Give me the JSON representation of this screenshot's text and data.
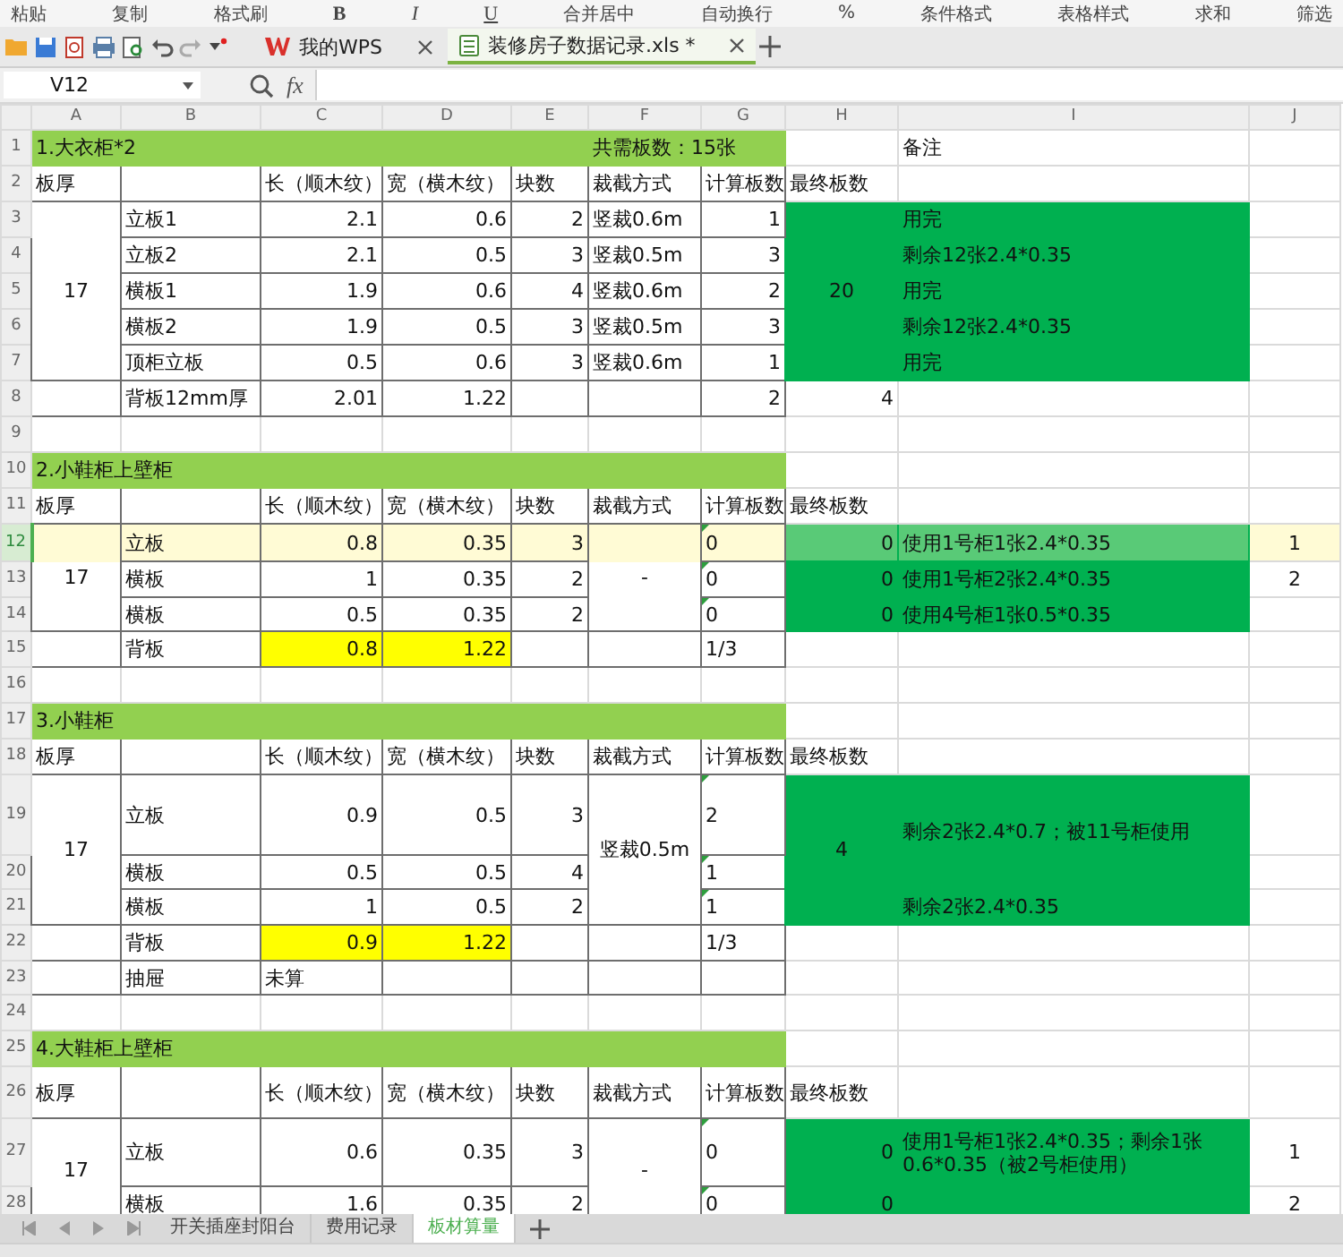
{
  "ribbon": [
    {
      "kind": "label",
      "text": "粘贴"
    },
    {
      "kind": "label",
      "text": "复制"
    },
    {
      "kind": "label",
      "text": "格式刷"
    },
    {
      "kind": "bold",
      "text": "B"
    },
    {
      "kind": "italic",
      "text": "I"
    },
    {
      "kind": "underline",
      "text": "U"
    },
    {
      "kind": "label",
      "text": "合并居中"
    },
    {
      "kind": "label",
      "text": "自动换行"
    },
    {
      "kind": "label",
      "text": "%"
    },
    {
      "kind": "label",
      "text": "条件格式"
    },
    {
      "kind": "label",
      "text": "表格样式"
    },
    {
      "kind": "label",
      "text": "求和"
    },
    {
      "kind": "label",
      "text": "筛选"
    }
  ],
  "doc_tabs": [
    {
      "label": "我的WPS",
      "kind": "home",
      "selected": false
    },
    {
      "label": "装修房子数据记录.xls *",
      "kind": "sheet",
      "selected": true
    }
  ],
  "formula_bar": {
    "cell_ref": "V12",
    "function_label": "fx"
  },
  "sheet": {
    "columns": [
      "A",
      "B",
      "C",
      "D",
      "E",
      "F",
      "G",
      "H",
      "I",
      "J"
    ],
    "rows": [
      {
        "number": "1",
        "selected": false,
        "framed": false,
        "cells": {
          "A": {
            "kind": "label",
            "text": "1.大衣柜*2",
            "color": "#92d050"
          },
          "F": {
            "kind": "label",
            "text": "共需板数：15张",
            "color": "#92d050"
          },
          "I": {
            "kind": "label",
            "text": "备注"
          }
        }
      },
      {
        "number": "2",
        "selected": false,
        "framed": true,
        "cells": {
          "A": {
            "kind": "label",
            "text": "板厚"
          },
          "C": {
            "kind": "label",
            "text": "长（顺木纹）"
          },
          "D": {
            "kind": "label",
            "text": "宽（横木纹）"
          },
          "E": {
            "kind": "label",
            "text": "块数"
          },
          "F": {
            "kind": "label",
            "text": "裁截方式"
          },
          "G": {
            "kind": "label",
            "text": "计算板数"
          },
          "H": {
            "kind": "label",
            "text": "最终板数"
          }
        }
      },
      {
        "number": "3",
        "selected": false,
        "framed": true,
        "cells": {
          "A": {
            "kind": "centered",
            "text": "17"
          },
          "B": {
            "kind": "label",
            "text": "立板1"
          },
          "C": {
            "kind": "number",
            "text": "2.1"
          },
          "D": {
            "kind": "number",
            "text": "0.6"
          },
          "E": {
            "kind": "number",
            "text": "2"
          },
          "F": {
            "kind": "label",
            "text": "竖裁0.6m"
          },
          "G": {
            "kind": "number",
            "text": "1"
          },
          "H": {
            "kind": "centered",
            "text": "20",
            "color": "#00b050"
          },
          "I": {
            "kind": "label",
            "text": "用完",
            "color": "#00b050"
          }
        }
      },
      {
        "number": "4",
        "selected": false,
        "framed": true,
        "cells": {
          "B": {
            "kind": "label",
            "text": "立板2"
          },
          "C": {
            "kind": "number",
            "text": "2.1"
          },
          "D": {
            "kind": "number",
            "text": "0.5"
          },
          "E": {
            "kind": "number",
            "text": "3"
          },
          "F": {
            "kind": "label",
            "text": "竖裁0.5m"
          },
          "G": {
            "kind": "number",
            "text": "3"
          },
          "I": {
            "kind": "label",
            "text": "剩余12张2.4*0.35",
            "color": "#00b050"
          }
        }
      },
      {
        "number": "5",
        "selected": false,
        "framed": true,
        "cells": {
          "B": {
            "kind": "label",
            "text": "横板1"
          },
          "C": {
            "kind": "number",
            "text": "1.9"
          },
          "D": {
            "kind": "number",
            "text": "0.6"
          },
          "E": {
            "kind": "number",
            "text": "4"
          },
          "F": {
            "kind": "label",
            "text": "竖裁0.6m"
          },
          "G": {
            "kind": "number",
            "text": "2"
          },
          "I": {
            "kind": "label",
            "text": "用完",
            "color": "#00b050"
          }
        }
      },
      {
        "number": "6",
        "selected": false,
        "framed": true,
        "cells": {
          "B": {
            "kind": "label",
            "text": "横板2"
          },
          "C": {
            "kind": "number",
            "text": "1.9"
          },
          "D": {
            "kind": "number",
            "text": "0.5"
          },
          "E": {
            "kind": "number",
            "text": "3"
          },
          "F": {
            "kind": "label",
            "text": "竖裁0.5m"
          },
          "G": {
            "kind": "number",
            "text": "3"
          },
          "I": {
            "kind": "label",
            "text": "剩余12张2.4*0.35",
            "color": "#00b050"
          }
        }
      },
      {
        "number": "7",
        "selected": false,
        "framed": true,
        "cells": {
          "B": {
            "kind": "label",
            "text": "顶柜立板"
          },
          "C": {
            "kind": "number",
            "text": "0.5"
          },
          "D": {
            "kind": "number",
            "text": "0.6"
          },
          "E": {
            "kind": "number",
            "text": "3"
          },
          "F": {
            "kind": "label",
            "text": "竖裁0.6m"
          },
          "G": {
            "kind": "number",
            "text": "1"
          },
          "I": {
            "kind": "label",
            "text": "用完",
            "color": "#00b050"
          }
        }
      },
      {
        "number": "8",
        "selected": false,
        "framed": true,
        "cells": {
          "B": {
            "kind": "label",
            "text": "背板12mm厚"
          },
          "C": {
            "kind": "number",
            "text": "2.01"
          },
          "D": {
            "kind": "number",
            "text": "1.22"
          },
          "G": {
            "kind": "number",
            "text": "2"
          },
          "H": {
            "kind": "number",
            "text": "4"
          }
        }
      },
      {
        "number": "9",
        "selected": false,
        "framed": false,
        "cells": {}
      },
      {
        "number": "10",
        "selected": false,
        "framed": false,
        "cells": {
          "A": {
            "kind": "label",
            "text": "2.小鞋柜上壁柜",
            "color": "#92d050"
          }
        }
      },
      {
        "number": "11",
        "selected": false,
        "framed": true,
        "cells": {
          "A": {
            "kind": "label",
            "text": "板厚"
          },
          "C": {
            "kind": "label",
            "text": "长（顺木纹）"
          },
          "D": {
            "kind": "label",
            "text": "宽（横木纹）"
          },
          "E": {
            "kind": "label",
            "text": "块数"
          },
          "F": {
            "kind": "label",
            "text": "裁截方式"
          },
          "G": {
            "kind": "label",
            "text": "计算板数"
          },
          "H": {
            "kind": "label",
            "text": "最终板数"
          }
        }
      },
      {
        "number": "12",
        "selected": true,
        "framed": true,
        "cells": {
          "A": {
            "kind": "centered",
            "text": "17"
          },
          "B": {
            "kind": "label",
            "text": "立板"
          },
          "C": {
            "kind": "number",
            "text": "0.8"
          },
          "D": {
            "kind": "number",
            "text": "0.35"
          },
          "E": {
            "kind": "number",
            "text": "3"
          },
          "F": {
            "kind": "centered",
            "text": "-"
          },
          "G": {
            "kind": "flagged",
            "text": "0"
          },
          "H": {
            "kind": "number",
            "text": "0",
            "color": "#00b050"
          },
          "I": {
            "kind": "label",
            "text": "使用1号柜1张2.4*0.35",
            "color": "#00b050"
          },
          "J": {
            "kind": "centered",
            "text": "1"
          }
        }
      },
      {
        "number": "13",
        "selected": false,
        "framed": true,
        "cells": {
          "B": {
            "kind": "label",
            "text": "横板"
          },
          "C": {
            "kind": "number",
            "text": "1"
          },
          "D": {
            "kind": "number",
            "text": "0.35"
          },
          "E": {
            "kind": "number",
            "text": "2"
          },
          "G": {
            "kind": "flagged",
            "text": "0"
          },
          "H": {
            "kind": "number",
            "text": "0",
            "color": "#00b050"
          },
          "I": {
            "kind": "label",
            "text": "使用1号柜2张2.4*0.35",
            "color": "#00b050"
          },
          "J": {
            "kind": "centered",
            "text": "2"
          }
        }
      },
      {
        "number": "14",
        "selected": false,
        "framed": true,
        "cells": {
          "B": {
            "kind": "label",
            "text": "横板"
          },
          "C": {
            "kind": "number",
            "text": "0.5"
          },
          "D": {
            "kind": "number",
            "text": "0.35"
          },
          "E": {
            "kind": "number",
            "text": "2"
          },
          "G": {
            "kind": "flagged",
            "text": "0"
          },
          "H": {
            "kind": "number",
            "text": "0",
            "color": "#00b050"
          },
          "I": {
            "kind": "label",
            "text": "使用4号柜1张0.5*0.35",
            "color": "#00b050"
          }
        }
      },
      {
        "number": "15",
        "selected": false,
        "framed": true,
        "cells": {
          "B": {
            "kind": "label",
            "text": "背板"
          },
          "C": {
            "kind": "number",
            "text": "0.8",
            "color": "#ffff00"
          },
          "D": {
            "kind": "number",
            "text": "1.22",
            "color": "#ffff00"
          },
          "G": {
            "kind": "label",
            "text": "1/3"
          }
        }
      },
      {
        "number": "16",
        "selected": false,
        "framed": false,
        "cells": {}
      },
      {
        "number": "17",
        "selected": false,
        "framed": false,
        "cells": {
          "A": {
            "kind": "label",
            "text": "3.小鞋柜",
            "color": "#92d050"
          }
        }
      },
      {
        "number": "18",
        "selected": false,
        "framed": true,
        "cells": {
          "A": {
            "kind": "label",
            "text": "板厚"
          },
          "C": {
            "kind": "label",
            "text": "长（顺木纹）"
          },
          "D": {
            "kind": "label",
            "text": "宽（横木纹）"
          },
          "E": {
            "kind": "label",
            "text": "块数"
          },
          "F": {
            "kind": "label",
            "text": "裁截方式"
          },
          "G": {
            "kind": "label",
            "text": "计算板数"
          },
          "H": {
            "kind": "label",
            "text": "最终板数"
          }
        }
      },
      {
        "number": "19",
        "selected": false,
        "framed": true,
        "cells": {
          "A": {
            "kind": "centered",
            "text": "17"
          },
          "B": {
            "kind": "label",
            "text": "立板"
          },
          "C": {
            "kind": "number",
            "text": "0.9"
          },
          "D": {
            "kind": "number",
            "text": "0.5"
          },
          "E": {
            "kind": "number",
            "text": "3"
          },
          "F": {
            "kind": "centered",
            "text": "竖裁0.5m"
          },
          "G": {
            "kind": "flagged",
            "text": "2"
          },
          "H": {
            "kind": "centered",
            "text": "4",
            "color": "#00b050"
          },
          "I": {
            "kind": "label",
            "text": "剩余2张2.4*0.7；被11号柜使用",
            "color": "#00b050"
          }
        }
      },
      {
        "number": "20",
        "selected": false,
        "framed": true,
        "cells": {
          "B": {
            "kind": "label",
            "text": "横板"
          },
          "C": {
            "kind": "number",
            "text": "0.5"
          },
          "D": {
            "kind": "number",
            "text": "0.5"
          },
          "E": {
            "kind": "number",
            "text": "4"
          },
          "G": {
            "kind": "flagged",
            "text": "1"
          }
        }
      },
      {
        "number": "21",
        "selected": false,
        "framed": true,
        "cells": {
          "B": {
            "kind": "label",
            "text": "横板"
          },
          "C": {
            "kind": "number",
            "text": "1"
          },
          "D": {
            "kind": "number",
            "text": "0.5"
          },
          "E": {
            "kind": "number",
            "text": "2"
          },
          "G": {
            "kind": "flagged",
            "text": "1"
          },
          "I": {
            "kind": "label",
            "text": "剩余2张2.4*0.35",
            "color": "#00b050"
          }
        }
      },
      {
        "number": "22",
        "selected": false,
        "framed": true,
        "cells": {
          "B": {
            "kind": "label",
            "text": "背板"
          },
          "C": {
            "kind": "number",
            "text": "0.9",
            "color": "#ffff00"
          },
          "D": {
            "kind": "number",
            "text": "1.22",
            "color": "#ffff00"
          },
          "G": {
            "kind": "label",
            "text": "1/3"
          }
        }
      },
      {
        "number": "23",
        "selected": false,
        "framed": true,
        "cells": {
          "B": {
            "kind": "label",
            "text": "抽屉"
          },
          "C": {
            "kind": "label",
            "text": "未算"
          }
        }
      },
      {
        "number": "24",
        "selected": false,
        "framed": false,
        "cells": {}
      },
      {
        "number": "25",
        "selected": false,
        "framed": false,
        "cells": {
          "A": {
            "kind": "label",
            "text": "4.大鞋柜上壁柜",
            "color": "#92d050"
          }
        }
      },
      {
        "number": "26",
        "selected": false,
        "framed": true,
        "cells": {
          "A": {
            "kind": "label",
            "text": "板厚"
          },
          "C": {
            "kind": "label",
            "text": "长（顺木纹）"
          },
          "D": {
            "kind": "label",
            "text": "宽（横木纹）"
          },
          "E": {
            "kind": "label",
            "text": "块数"
          },
          "F": {
            "kind": "label",
            "text": "裁截方式"
          },
          "G": {
            "kind": "label",
            "text": "计算板数"
          },
          "H": {
            "kind": "label",
            "text": "最终板数"
          }
        }
      },
      {
        "number": "27",
        "selected": false,
        "framed": true,
        "cells": {
          "A": {
            "kind": "centered",
            "text": "17"
          },
          "B": {
            "kind": "label",
            "text": "立板"
          },
          "C": {
            "kind": "number",
            "text": "0.6"
          },
          "D": {
            "kind": "number",
            "text": "0.35"
          },
          "E": {
            "kind": "number",
            "text": "3"
          },
          "F": {
            "kind": "centered",
            "text": "-"
          },
          "G": {
            "kind": "flagged",
            "text": "0"
          },
          "H": {
            "kind": "number",
            "text": "0",
            "color": "#00b050"
          },
          "I": {
            "kind": "note",
            "text": "使用1号柜1张2.4*0.35；剩余1张0.6*0.35（被2号柜使用）",
            "color": "#00b050"
          },
          "J": {
            "kind": "centered",
            "text": "1"
          }
        }
      },
      {
        "number": "28",
        "selected": false,
        "framed": true,
        "cells": {
          "B": {
            "kind": "label",
            "text": "横板"
          },
          "C": {
            "kind": "number",
            "text": "1.6"
          },
          "D": {
            "kind": "number",
            "text": "0.35"
          },
          "E": {
            "kind": "number",
            "text": "2"
          },
          "G": {
            "kind": "flagged",
            "text": "0"
          },
          "H": {
            "kind": "number",
            "text": "0",
            "color": "#00b050"
          },
          "I": {
            "kind": "label",
            "color": "#00b050"
          },
          "J": {
            "kind": "centered",
            "text": "2"
          }
        }
      }
    ]
  },
  "sheet_tabs": [
    {
      "label": "开关插座封阳台",
      "selected": false
    },
    {
      "label": "费用记录",
      "selected": false
    },
    {
      "label": "板材算量",
      "selected": true
    }
  ]
}
